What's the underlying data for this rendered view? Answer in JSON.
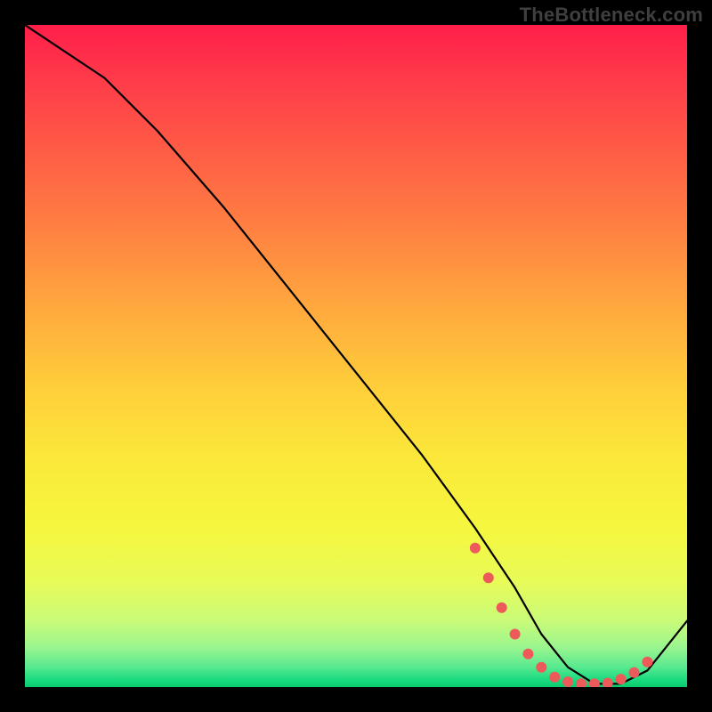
{
  "watermark": "TheBottleneck.com",
  "chart_data": {
    "type": "line",
    "title": "",
    "xlabel": "",
    "ylabel": "",
    "xlim": [
      0,
      100
    ],
    "ylim": [
      0,
      100
    ],
    "series": [
      {
        "name": "curve",
        "x": [
          0,
          12,
          20,
          30,
          40,
          50,
          60,
          68,
          74,
          78,
          82,
          86,
          90,
          94,
          100
        ],
        "y": [
          100,
          92,
          84,
          72.5,
          60,
          47.5,
          35,
          24,
          15,
          8,
          3,
          0.5,
          0.5,
          2.5,
          10
        ]
      }
    ],
    "markers": {
      "name": "highlight-dots",
      "color": "#ec5a5a",
      "x": [
        68,
        70,
        72,
        74,
        76,
        78,
        80,
        82,
        84,
        86,
        88,
        90,
        92,
        94
      ],
      "y": [
        21,
        16.5,
        12,
        8,
        5,
        3,
        1.5,
        0.8,
        0.5,
        0.5,
        0.6,
        1.2,
        2.2,
        3.8
      ]
    },
    "gradient_stops": [
      {
        "pos": 0.0,
        "color": "#ff1e4a"
      },
      {
        "pos": 0.5,
        "color": "#ffcf3a"
      },
      {
        "pos": 0.8,
        "color": "#f5f73e"
      },
      {
        "pos": 1.0,
        "color": "#0bc96d"
      }
    ]
  }
}
